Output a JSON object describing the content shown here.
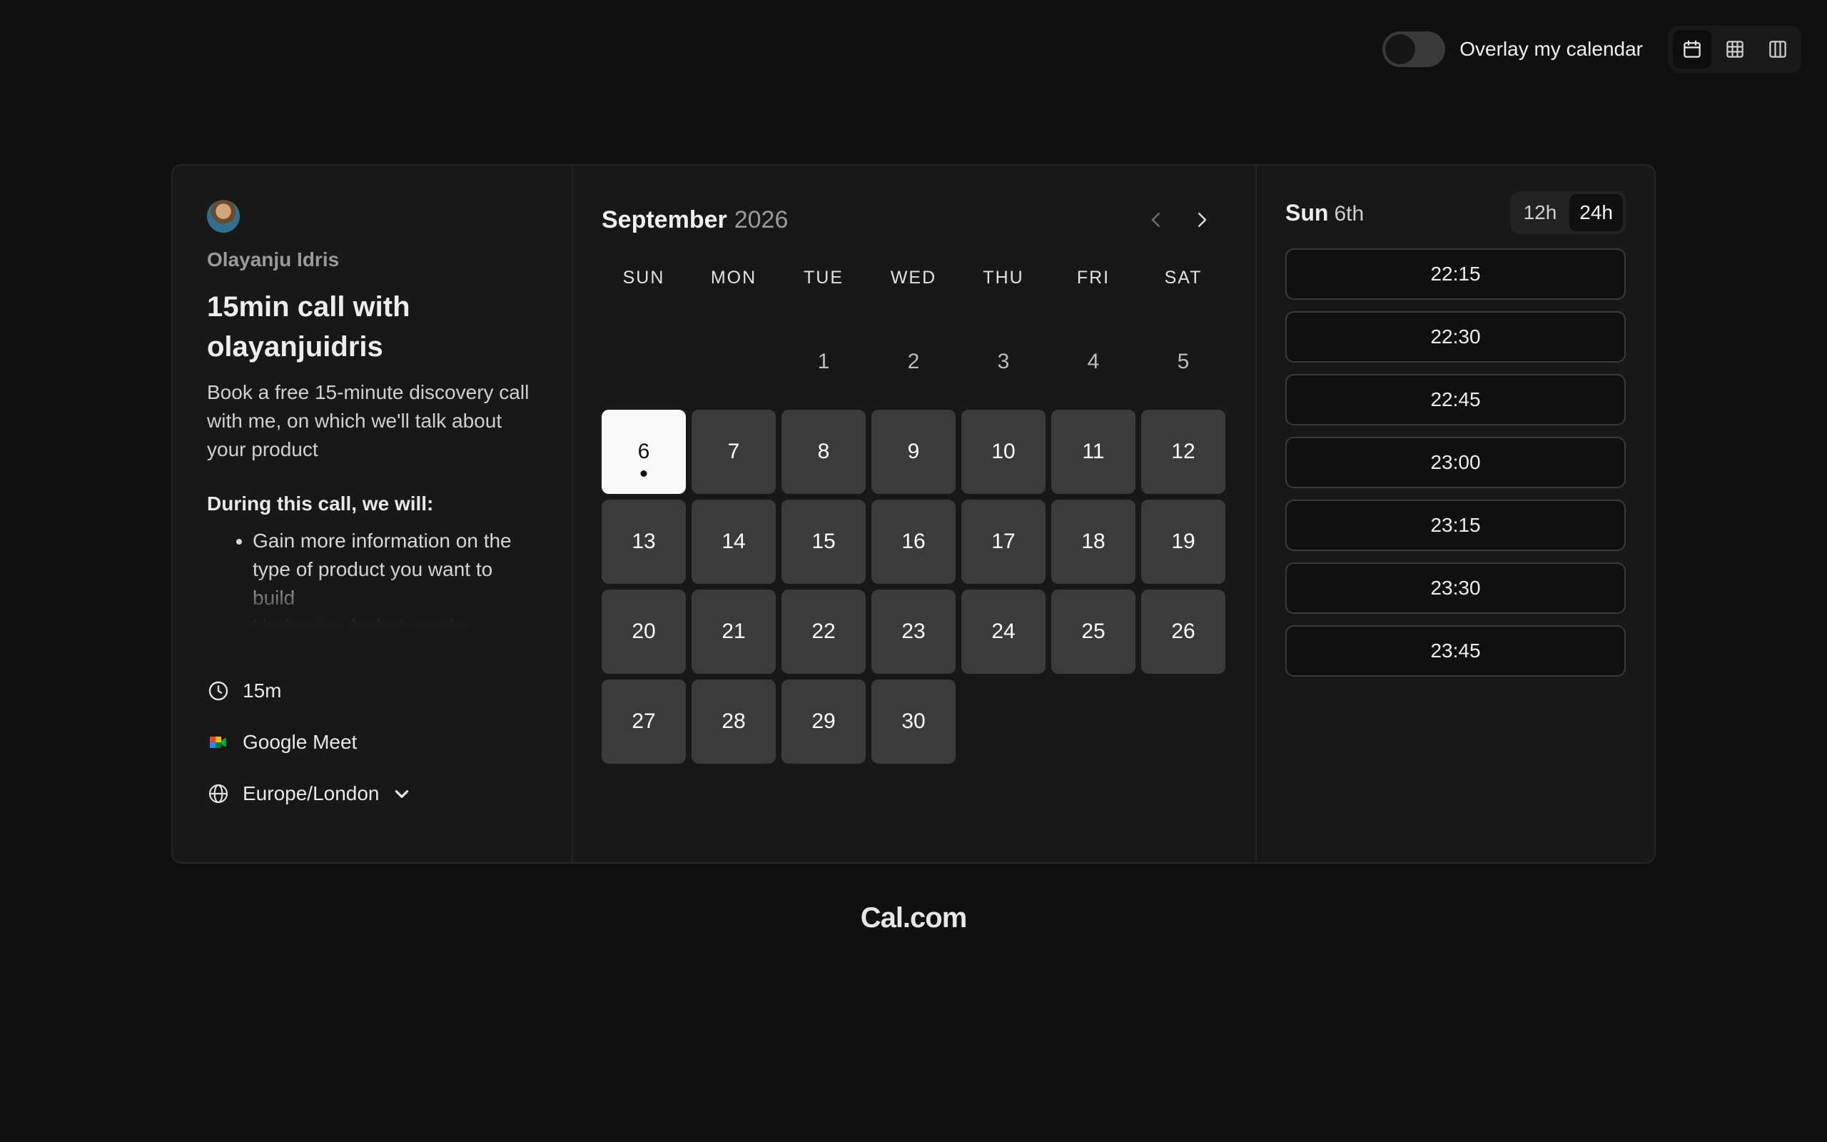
{
  "topbar": {
    "overlay_label": "Overlay my calendar",
    "overlay_enabled": false,
    "views": [
      {
        "name": "month-view",
        "icon": "calendar-icon",
        "active": true
      },
      {
        "name": "week-view",
        "icon": "grid-icon",
        "active": false
      },
      {
        "name": "column-view",
        "icon": "columns-icon",
        "active": false
      }
    ]
  },
  "event": {
    "host": "Olayanju Idris",
    "title": "15min call with olayanjuidris",
    "description": "Book a free 15-minute discovery call with me, on which we'll talk about your product",
    "list_heading": "During this call, we will:",
    "bullets": [
      "Gain more information on the type of product you want to build",
      "Understand what are the"
    ],
    "duration": "15m",
    "location": "Google Meet",
    "timezone": "Europe/London"
  },
  "calendar": {
    "month": "September",
    "year": "2026",
    "weekdays": [
      "SUN",
      "MON",
      "TUE",
      "WED",
      "THU",
      "FRI",
      "SAT"
    ],
    "leading_blanks": 2,
    "unavailable_days": [
      "1",
      "2",
      "3",
      "4",
      "5"
    ],
    "available_days": [
      "6",
      "7",
      "8",
      "9",
      "10",
      "11",
      "12",
      "13",
      "14",
      "15",
      "16",
      "17",
      "18",
      "19",
      "20",
      "21",
      "22",
      "23",
      "24",
      "25",
      "26",
      "27",
      "28",
      "29",
      "30"
    ],
    "selected_day": "6"
  },
  "slots": {
    "day": "Sun",
    "date": "6th",
    "format_12": "12h",
    "format_24": "24h",
    "active_format": "24h",
    "times": [
      "22:15",
      "22:30",
      "22:45",
      "23:00",
      "23:15",
      "23:30",
      "23:45"
    ]
  },
  "footer": {
    "brand": "Cal.com"
  },
  "colors": {
    "background": "#101010",
    "card": "#181818",
    "day_available": "#3b3b3b",
    "day_selected": "#f9f9f9"
  }
}
